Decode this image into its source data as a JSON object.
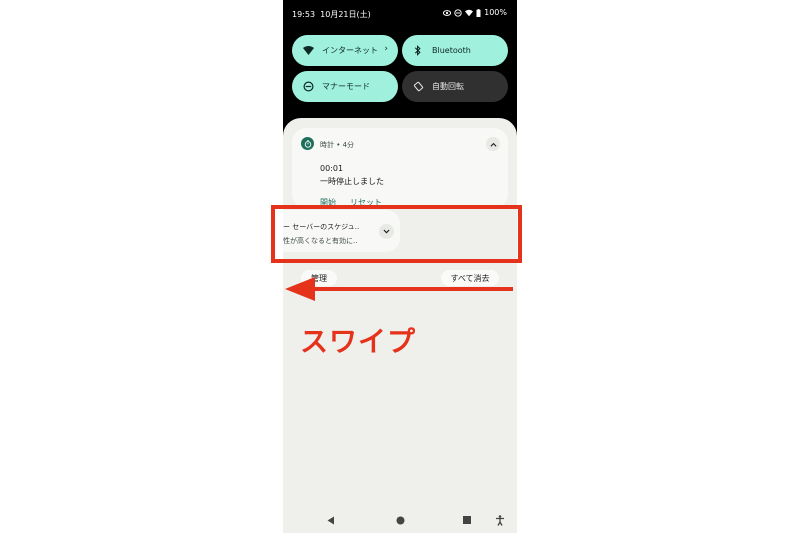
{
  "status_bar": {
    "time": "19:53",
    "date": "10月21日(土)",
    "battery": "100%",
    "icons": [
      "eye-icon",
      "do-not-disturb-icon",
      "wifi-icon",
      "battery-icon"
    ]
  },
  "quick_settings": {
    "tiles": [
      {
        "label": "インターネット",
        "icon": "wifi-icon",
        "state": "on"
      },
      {
        "label": "Bluetooth",
        "icon": "bluetooth-icon",
        "state": "on"
      },
      {
        "label": "マナーモード",
        "icon": "do-not-disturb-icon",
        "state": "on"
      },
      {
        "label": "自動回転",
        "icon": "auto-rotate-icon",
        "state": "off"
      }
    ]
  },
  "notifications": {
    "clock": {
      "header": "時計 • 4分",
      "title": "00:01",
      "text": "一時停止しました",
      "actions": [
        "開始",
        "リセット"
      ]
    },
    "battery_saver": {
      "line1": "ー セーバーのスケジュ‥",
      "line2": "性が高くなると有効に‥"
    }
  },
  "shade_buttons": {
    "manage": "管理",
    "clear_all": "すべて消去"
  },
  "annotation": {
    "label": "スワイプ",
    "color": "#e5321b"
  },
  "colors": {
    "tile_on": "#9ff0dd",
    "tile_off": "#2f302f",
    "accent": "#1e6e5c"
  }
}
